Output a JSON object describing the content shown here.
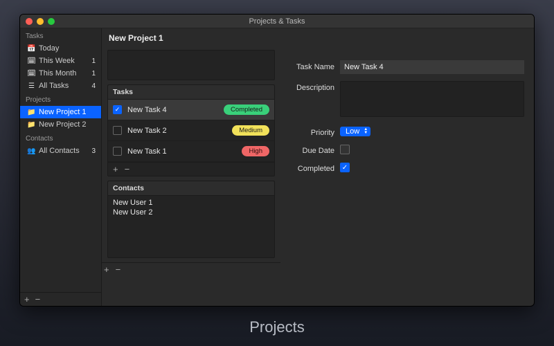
{
  "window": {
    "title": "Projects & Tasks"
  },
  "sidebar": {
    "groups": [
      {
        "title": "Tasks",
        "items": [
          {
            "icon": "📅",
            "label": "Today",
            "count": ""
          },
          {
            "icon": "🗓",
            "label": "This Week",
            "count": "1"
          },
          {
            "icon": "🗓",
            "label": "This Month",
            "count": "1"
          },
          {
            "icon": "☰",
            "label": "All Tasks",
            "count": "4"
          }
        ]
      },
      {
        "title": "Projects",
        "items": [
          {
            "icon": "📁",
            "label": "New Project 1",
            "count": "",
            "selected": true
          },
          {
            "icon": "📁",
            "label": "New Project 2",
            "count": ""
          }
        ]
      },
      {
        "title": "Contacts",
        "items": [
          {
            "icon": "👥",
            "label": "All Contacts",
            "count": "3"
          }
        ]
      }
    ]
  },
  "project": {
    "title": "New Project 1",
    "tasks_header": "Tasks",
    "tasks": [
      {
        "name": "New Task 4",
        "checked": true,
        "badge": "Completed",
        "badge_style": "b-green",
        "selected": true
      },
      {
        "name": "New Task 2",
        "checked": false,
        "badge": "Medium",
        "badge_style": "b-yellow"
      },
      {
        "name": "New Task 1",
        "checked": false,
        "badge": "High",
        "badge_style": "b-red"
      }
    ],
    "contacts_header": "Contacts",
    "contacts": [
      "New User 1",
      "New User 2"
    ]
  },
  "detail": {
    "labels": {
      "task_name": "Task Name",
      "description": "Description",
      "priority": "Priority",
      "due_date": "Due Date",
      "completed": "Completed"
    },
    "task_name": "New Task 4",
    "description": "",
    "priority": "Low",
    "due_date_set": false,
    "completed": true
  },
  "glyph": {
    "plus": "+",
    "minus": "−",
    "check": "✓"
  },
  "caption": "Projects"
}
